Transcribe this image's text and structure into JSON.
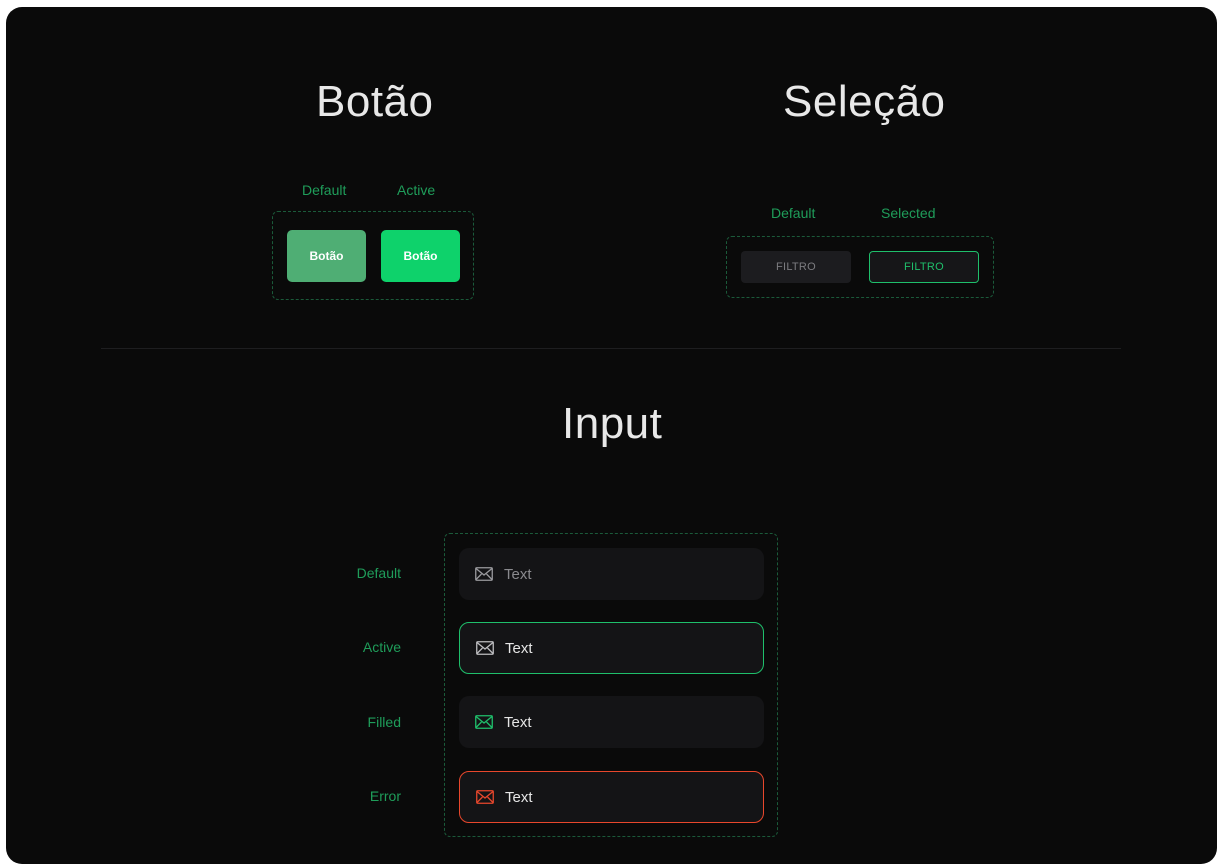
{
  "buttons_section": {
    "title": "Botão",
    "states": {
      "default": "Default",
      "active": "Active"
    },
    "button_label_default": "Botão",
    "button_label_active": "Botão",
    "colors": {
      "default": "#4fae74",
      "active": "#0ed26b"
    }
  },
  "selection_section": {
    "title": "Seleção",
    "states": {
      "default": "Default",
      "selected": "Selected"
    },
    "chip_label_default": "FILTRO",
    "chip_label_selected": "FILTRO",
    "colors": {
      "selected_border": "#1fbf6b"
    }
  },
  "input_section": {
    "title": "Input",
    "rows": [
      {
        "state": "Default",
        "value": "Text",
        "icon": "mail-icon",
        "icon_color": "#9a9a9e"
      },
      {
        "state": "Active",
        "value": "Text",
        "icon": "mail-icon",
        "icon_color": "#bdbdc0",
        "border_color": "#1fbf6b"
      },
      {
        "state": "Filled",
        "value": "Text",
        "icon": "mail-icon",
        "icon_color": "#1fbf6b"
      },
      {
        "state": "Error",
        "value": "Text",
        "icon": "mail-icon",
        "icon_color": "#e8472c",
        "border_color": "#e8472c"
      }
    ]
  }
}
